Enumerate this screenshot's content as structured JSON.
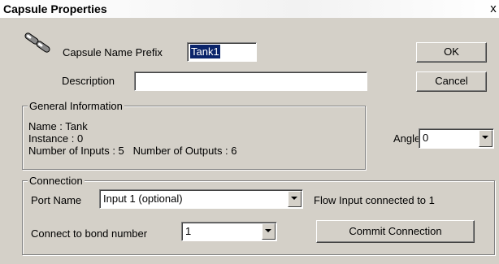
{
  "window": {
    "title": "Capsule Properties",
    "close_label": "x"
  },
  "capsule": {
    "name_prefix_label": "Capsule Name Prefix",
    "name_prefix_value": "Tank1",
    "description_label": "Description",
    "description_value": ""
  },
  "buttons": {
    "ok": "OK",
    "cancel": "Cancel",
    "commit": "Commit Connection"
  },
  "general_info": {
    "legend": "General Information",
    "name_line": "Name : Tank",
    "instance_line": "Instance : 0",
    "io_line": "Number of Inputs : 5   Number of Outputs : 6"
  },
  "angle": {
    "label": "Angle",
    "value": "0"
  },
  "connection": {
    "legend": "Connection",
    "port_name_label": "Port Name",
    "port_name_value": "Input 1 (optional)",
    "status_text": "Flow Input connected to 1",
    "bond_label": "Connect to bond number",
    "bond_value": "1"
  },
  "icons": {
    "capsule_icon": "capsule-icon",
    "dropdown_icon": "chevron-down-icon"
  }
}
